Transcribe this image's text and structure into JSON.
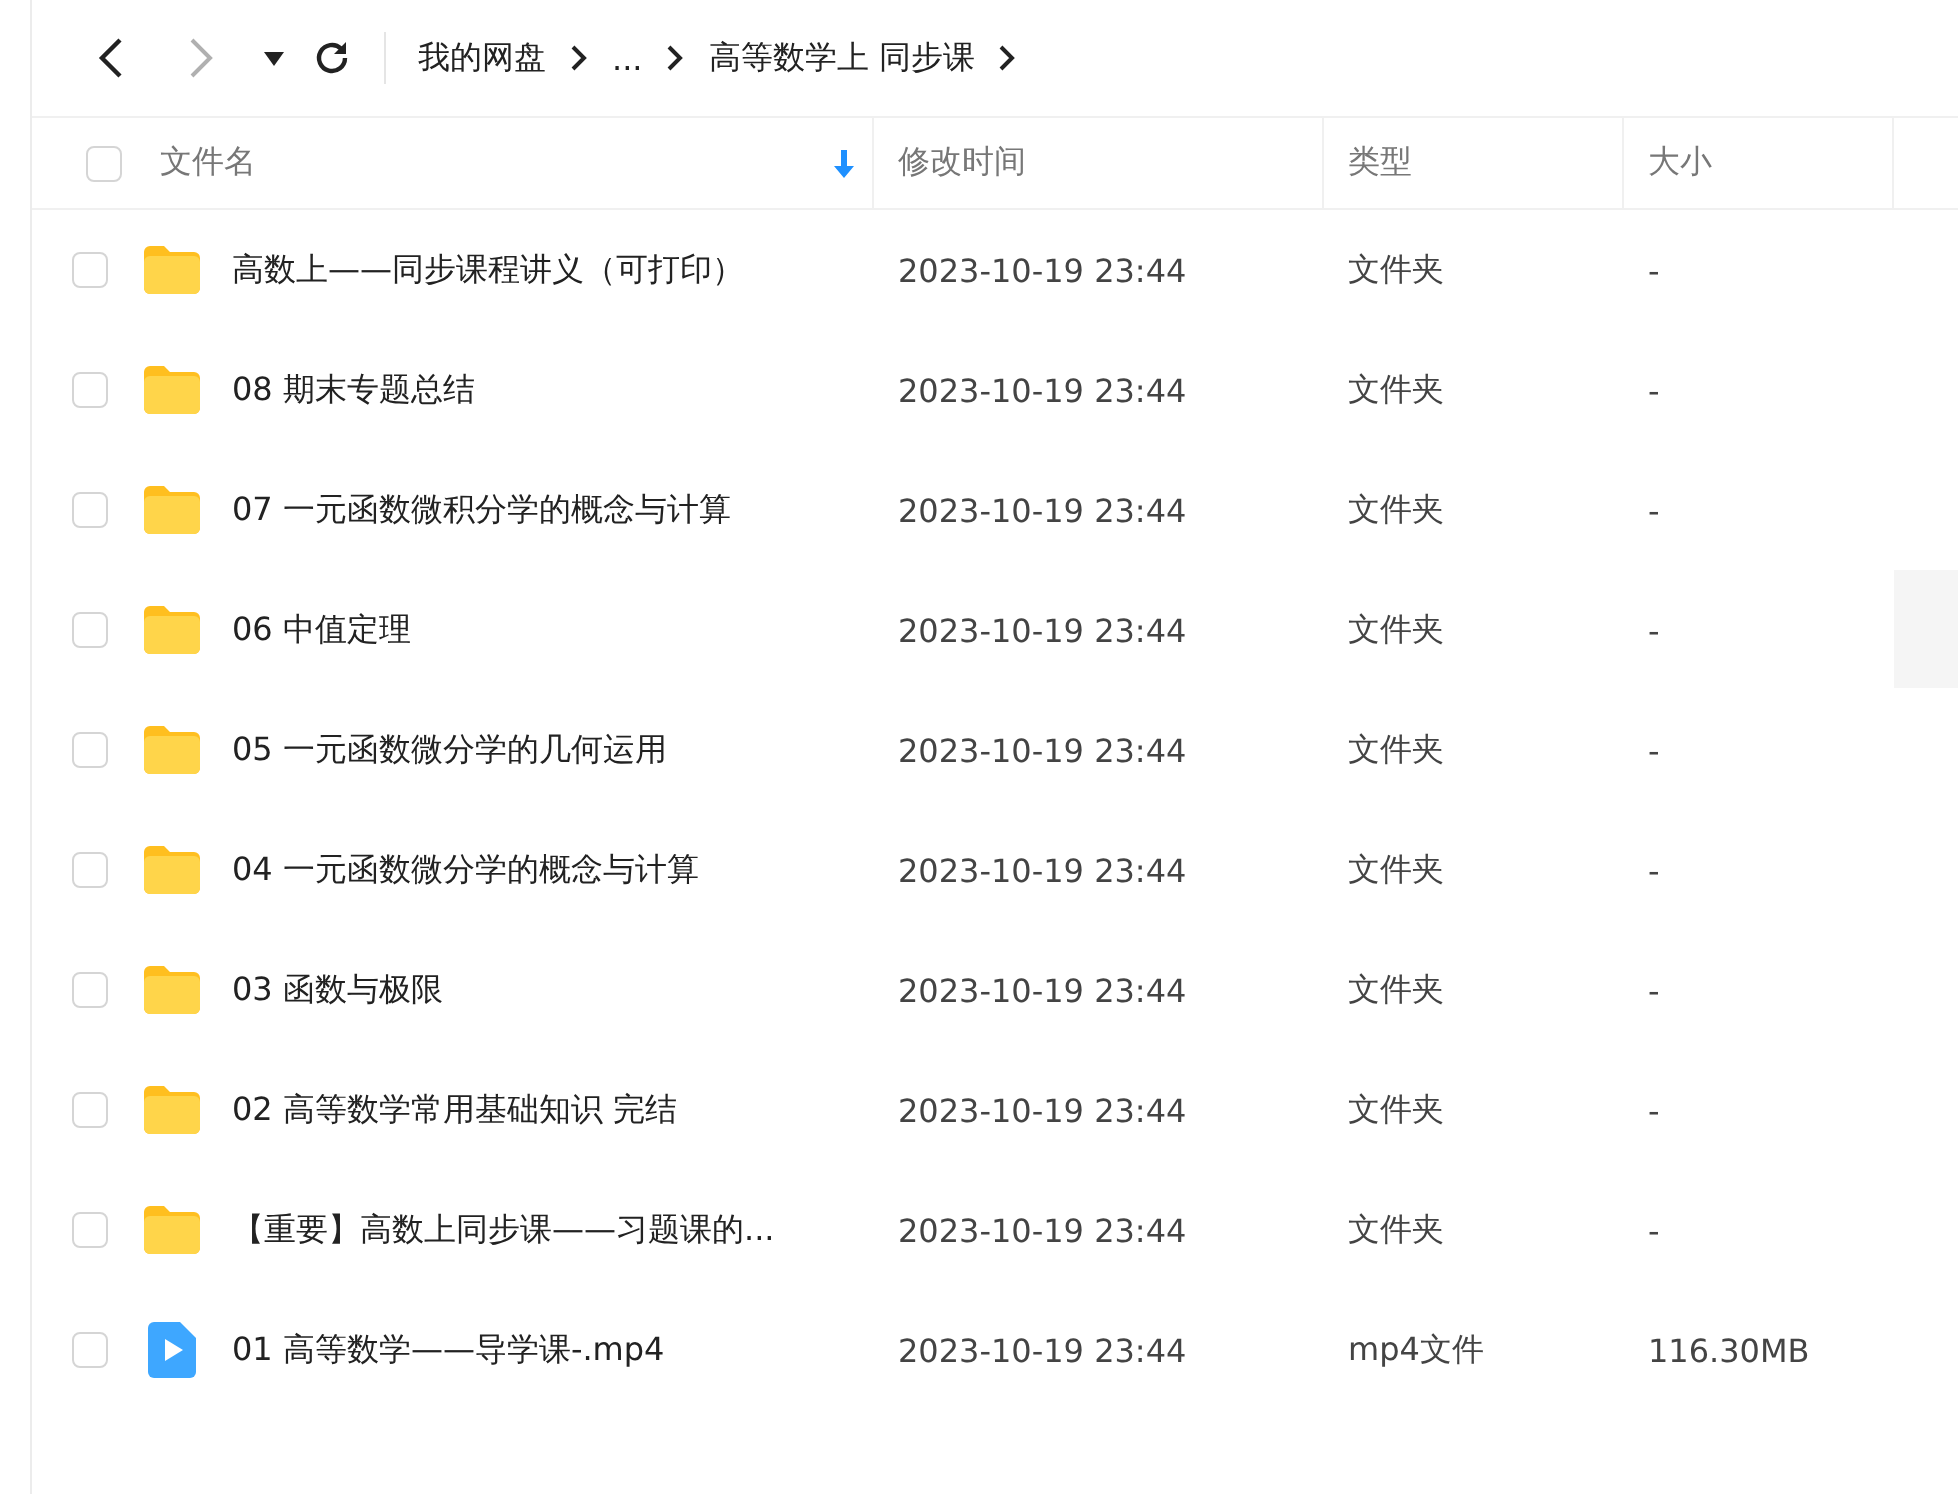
{
  "toolbar": {
    "back": {
      "disabled": false
    },
    "forward": {
      "disabled": true
    },
    "breadcrumb": [
      {
        "label": "我的网盘"
      },
      {
        "label": "..."
      },
      {
        "label": "高等数学上 同步课"
      }
    ]
  },
  "table": {
    "select_all": {
      "checked": false
    },
    "columns": [
      {
        "label": "文件名",
        "sorted": true
      },
      {
        "label": "修改时间",
        "sorted": false
      },
      {
        "label": "类型",
        "sorted": false
      },
      {
        "label": "大小",
        "sorted": false
      }
    ],
    "rows": [
      {
        "kind": "folder",
        "checked": false,
        "name": "高数上——同步课程讲义（可打印）",
        "modified": "2023-10-19 23:44",
        "type": "文件夹",
        "size": "-"
      },
      {
        "kind": "folder",
        "checked": false,
        "name": "08 期末专题总结",
        "modified": "2023-10-19 23:44",
        "type": "文件夹",
        "size": "-"
      },
      {
        "kind": "folder",
        "checked": false,
        "name": "07 一元函数微积分学的概念与计算",
        "modified": "2023-10-19 23:44",
        "type": "文件夹",
        "size": "-"
      },
      {
        "kind": "folder",
        "checked": false,
        "name": "06 中值定理",
        "modified": "2023-10-19 23:44",
        "type": "文件夹",
        "size": "-"
      },
      {
        "kind": "folder",
        "checked": false,
        "name": "05 一元函数微分学的几何运用",
        "modified": "2023-10-19 23:44",
        "type": "文件夹",
        "size": "-"
      },
      {
        "kind": "folder",
        "checked": false,
        "name": "04 一元函数微分学的概念与计算",
        "modified": "2023-10-19 23:44",
        "type": "文件夹",
        "size": "-"
      },
      {
        "kind": "folder",
        "checked": false,
        "name": "03 函数与极限",
        "modified": "2023-10-19 23:44",
        "type": "文件夹",
        "size": "-"
      },
      {
        "kind": "folder",
        "checked": false,
        "name": "02 高等数学常用基础知识 完结",
        "modified": "2023-10-19 23:44",
        "type": "文件夹",
        "size": "-"
      },
      {
        "kind": "folder",
        "checked": false,
        "name": "【重要】高数上同步课——习题课的...",
        "modified": "2023-10-19 23:44",
        "type": "文件夹",
        "size": "-"
      },
      {
        "kind": "video",
        "checked": false,
        "name": "01 高等数学——导学课-.mp4",
        "modified": "2023-10-19 23:44",
        "type": "mp4文件",
        "size": "116.30MB"
      }
    ]
  }
}
